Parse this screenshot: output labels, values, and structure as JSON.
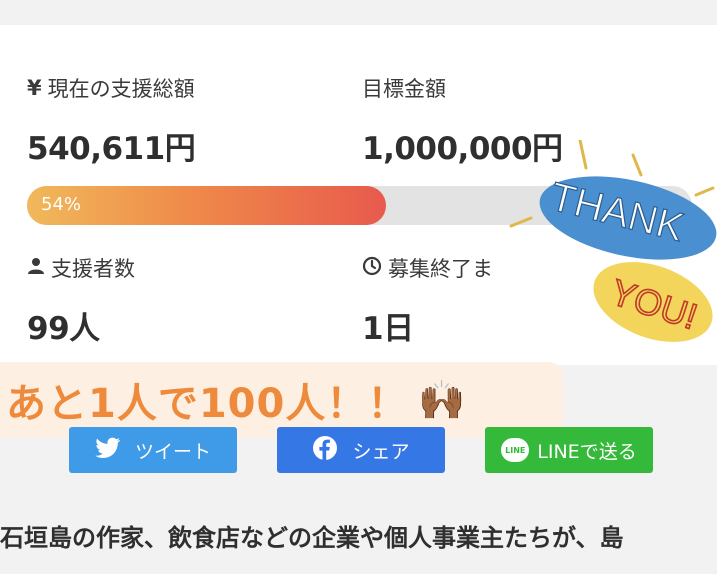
{
  "stats": {
    "total_label": "現在の支援総額",
    "total_icon": "yen-icon",
    "total_value": "540,611円",
    "goal_label": "目標金額",
    "goal_value": "1,000,000円",
    "progress_percent": 54,
    "progress_text": "54%",
    "supporters_label": "支援者数",
    "supporters_icon": "person-icon",
    "supporters_value": "99人",
    "deadline_label": "募集終了ま",
    "deadline_icon": "clock-icon",
    "deadline_value": "1日"
  },
  "sticker": {
    "line1": "THANK",
    "line2": "YOU!",
    "colors": {
      "blue": "#4a90d0",
      "yellow": "#f2d55a",
      "red": "#c0392b"
    }
  },
  "banner": {
    "text": "あと1人で100人！！",
    "emoji": "🙌🏾"
  },
  "share": {
    "tweet_label": "ツイート",
    "share_label": "シェア",
    "line_label": "LINEで送る",
    "line_badge": "LINE"
  },
  "description": {
    "text": "石垣島の作家、飲食店などの企業や個人事業主たちが、島"
  },
  "colors": {
    "accent_orange": "#ee8a3c",
    "twitter": "#3f9ae8",
    "facebook": "#3578e5",
    "line": "#35b93a"
  }
}
